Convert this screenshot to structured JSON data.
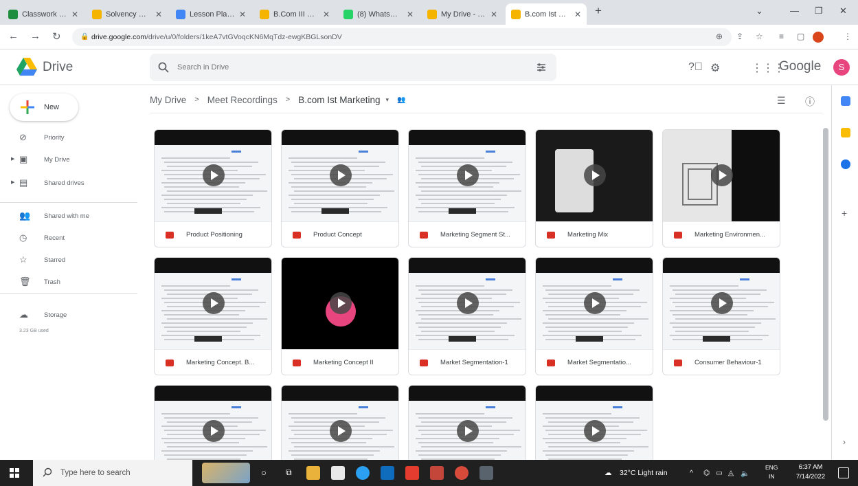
{
  "browser": {
    "tabs": [
      {
        "label": "Classwork for B.",
        "color": "#1e8e3e"
      },
      {
        "label": "Solvency Ratio",
        "color": "#f4b400"
      },
      {
        "label": "Lesson Plan Me",
        "color": "#4285f4"
      },
      {
        "label": "B.Com III 4th Se",
        "color": "#f4b400"
      },
      {
        "label": "(8) WhatsApp",
        "color": "#25d366"
      },
      {
        "label": "My Drive - Goo",
        "color": "#f4b400"
      },
      {
        "label": "B.com Ist Marke",
        "color": "#f4b400",
        "active": true
      }
    ],
    "new_tab": "+",
    "url_domain": "drive.google.com",
    "url_path": "/drive/u/0/folders/1keA7vtGVoqcKN6MqTdz-ewgKBGLsonDV"
  },
  "drive": {
    "product": "Drive",
    "search_placeholder": "Search in Drive",
    "google_word": "Google",
    "avatar_letter": "S",
    "new_label": "New",
    "nav": [
      {
        "label": "Priority",
        "icon": "priority-icon"
      },
      {
        "label": "My Drive",
        "icon": "my-drive-icon",
        "expandable": true
      },
      {
        "label": "Shared drives",
        "icon": "shared-drives-icon",
        "expandable": true
      },
      {
        "label": "Shared with me",
        "icon": "shared-with-me-icon"
      },
      {
        "label": "Recent",
        "icon": "recent-icon"
      },
      {
        "label": "Starred",
        "icon": "starred-icon"
      },
      {
        "label": "Trash",
        "icon": "trash-icon"
      },
      {
        "label": "Storage",
        "icon": "storage-icon"
      }
    ],
    "storage_used": "3.23 GB used",
    "breadcrumb": [
      "My Drive",
      "Meet Recordings",
      "B.com Ist Marketing"
    ],
    "files": [
      "Product Positioning",
      "Product Concept",
      "Marketing Segment St...",
      "Marketing Mix",
      "Marketing Environmen...",
      "Marketing Concept. B...",
      "Marketing Concept II",
      "Market Segmentation-1",
      "Market Segmentatio...",
      "Consumer Behaviour-1",
      "",
      "",
      "",
      ""
    ]
  },
  "taskbar": {
    "search_placeholder": "Type here to search",
    "weather": "32°C  Light rain",
    "lang_top": "ENG",
    "lang_bottom": "IN",
    "time": "6:37 AM",
    "date": "7/14/2022"
  }
}
